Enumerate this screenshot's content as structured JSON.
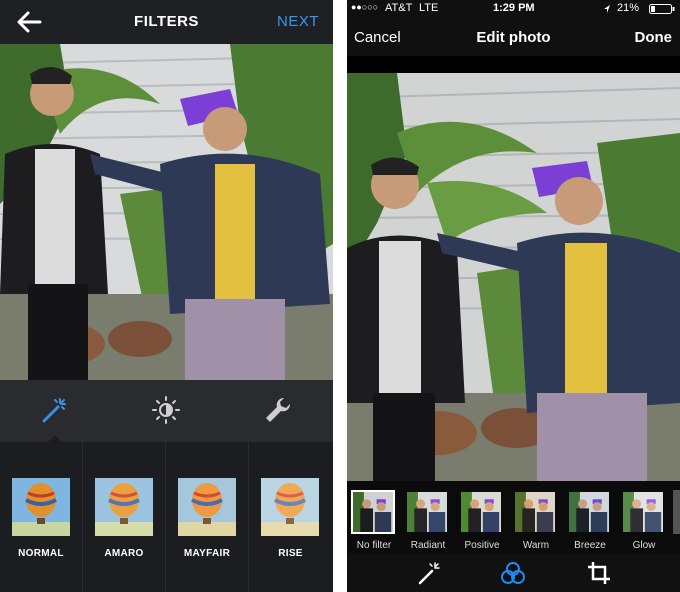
{
  "left": {
    "title": "FILTERS",
    "next_label": "NEXT",
    "back_icon": "back-arrow-icon",
    "tools": [
      {
        "icon": "magic-wand-icon",
        "active": true
      },
      {
        "icon": "brightness-icon",
        "active": false
      },
      {
        "icon": "wrench-icon",
        "active": false
      }
    ],
    "filters": [
      {
        "label": "NORMAL"
      },
      {
        "label": "AMARO"
      },
      {
        "label": "MAYFAIR"
      },
      {
        "label": "RISE"
      }
    ]
  },
  "right": {
    "status": {
      "signal": "●●○○○",
      "carrier": "AT&T",
      "network": "LTE",
      "time": "1:29 PM",
      "battery": "21%"
    },
    "nav": {
      "cancel": "Cancel",
      "title": "Edit photo",
      "done": "Done"
    },
    "filters": [
      {
        "label": "No filter",
        "selected": true
      },
      {
        "label": "Radiant",
        "selected": false
      },
      {
        "label": "Positive",
        "selected": false
      },
      {
        "label": "Warm",
        "selected": false
      },
      {
        "label": "Breeze",
        "selected": false
      },
      {
        "label": "Glow",
        "selected": false
      }
    ],
    "bottom_tools": [
      {
        "icon": "magic-wand-icon"
      },
      {
        "icon": "filters-circles-icon"
      },
      {
        "icon": "crop-icon"
      }
    ]
  },
  "colors": {
    "accent_blue": "#3897f0",
    "ios_blue": "#1e88f5"
  }
}
